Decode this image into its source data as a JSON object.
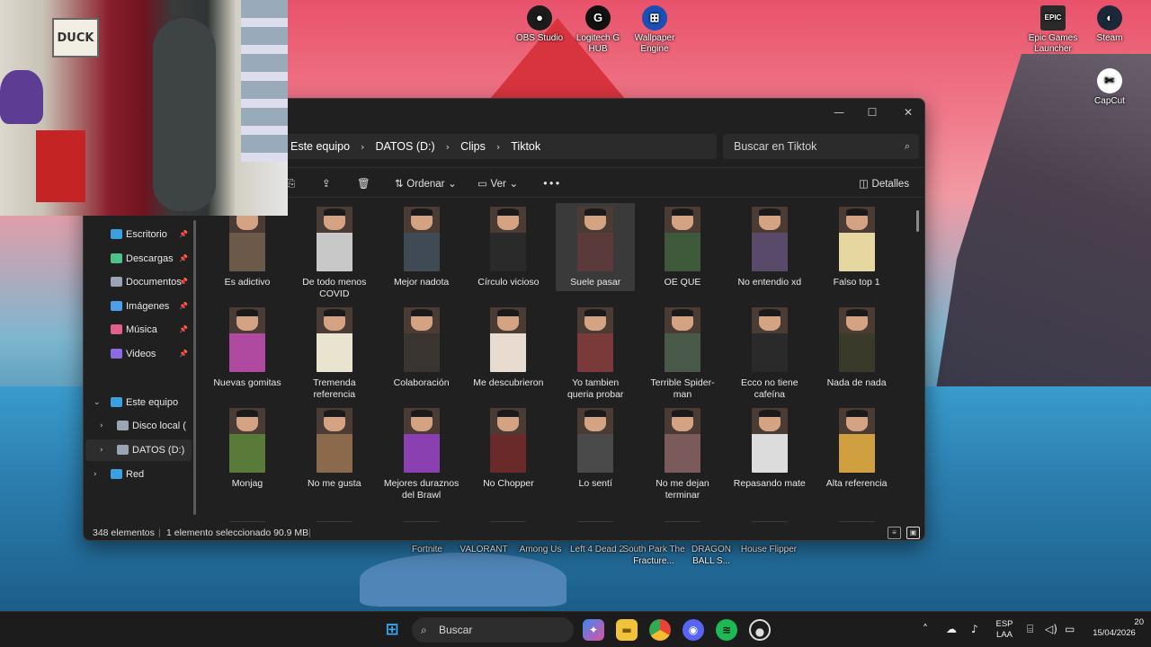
{
  "desktop": {
    "icons_top": [
      {
        "label": "OBS Studio",
        "icon": "obs-icon",
        "color": "#1b1b1b",
        "glyph": "●"
      },
      {
        "label": "Logitech G HUB",
        "icon": "logitech-icon",
        "color": "#111111",
        "glyph": "G"
      },
      {
        "label": "Wallpaper Engine",
        "icon": "wallpaper-engine-icon",
        "color": "#1a4fb5",
        "glyph": "⊞"
      },
      {
        "label": "Epic Games Launcher",
        "icon": "epic-games-icon",
        "color": "#2a2a2a",
        "glyph": "EPIC"
      },
      {
        "label": "Steam",
        "icon": "steam-icon",
        "color": "#1b2838",
        "glyph": "◐"
      },
      {
        "label": "CapCut",
        "icon": "capcut-icon",
        "color": "#ffffff",
        "glyph": "✂"
      }
    ],
    "icons_bottom": [
      "Fortnite",
      "VALORANT",
      "Among Us",
      "Left 4 Dead 2",
      "South Park The Fracture...",
      "DRAGON BALL S...",
      "House Flipper"
    ]
  },
  "webcam": {
    "sign_text": "DUCK"
  },
  "explorer": {
    "breadcrumb": [
      "Este equipo",
      "DATOS (D:)",
      "Clips",
      "Tiktok"
    ],
    "search_placeholder": "Buscar en Tiktok",
    "toolbar": {
      "sort_label": "Ordenar",
      "view_label": "Ver",
      "more_label": "•••",
      "details_label": "Detalles"
    },
    "nav": [
      {
        "label": "Escritorio",
        "icon": "desktop-icon",
        "color": "#3aa0e0",
        "pinned": true
      },
      {
        "label": "Descargas",
        "icon": "download-icon",
        "color": "#4cc28a",
        "pinned": true
      },
      {
        "label": "Documentos",
        "icon": "documents-icon",
        "color": "#9aa4b2",
        "pinned": true
      },
      {
        "label": "Imágenes",
        "icon": "images-icon",
        "color": "#4f9ee8",
        "pinned": true
      },
      {
        "label": "Música",
        "icon": "music-icon",
        "color": "#e0608a",
        "pinned": true
      },
      {
        "label": "Videos",
        "icon": "videos-icon",
        "color": "#8a6be0",
        "pinned": true
      },
      {
        "label": "Este equipo",
        "icon": "this-pc-icon",
        "color": "#3aa0e0",
        "pinned": false,
        "expanded": true
      },
      {
        "label": "Disco local (C:)",
        "icon": "drive-icon",
        "color": "#9aa4b2",
        "pinned": false,
        "expanded": false
      },
      {
        "label": "DATOS (D:)",
        "icon": "drive-icon",
        "color": "#9aa4b2",
        "pinned": false,
        "expanded": false,
        "selected": true
      },
      {
        "label": "Red",
        "icon": "network-icon",
        "color": "#3aa0e0",
        "pinned": false,
        "expanded": false
      }
    ],
    "files": [
      {
        "name": "Es adictivo",
        "bg": "#6b5a4a"
      },
      {
        "name": "De todo menos COVID",
        "bg": "#c8c8c8"
      },
      {
        "name": "Mejor nadota",
        "bg": "#3f4a55"
      },
      {
        "name": "Círculo vicioso",
        "bg": "#2a2a2a"
      },
      {
        "name": "Suele pasar",
        "bg": "#5a3a3a",
        "selected": true
      },
      {
        "name": "OE QUE",
        "bg": "#3e5a3a"
      },
      {
        "name": "No entendio xd",
        "bg": "#5a4a6a"
      },
      {
        "name": "Falso top 1",
        "bg": "#e6d6a0"
      },
      {
        "name": "Nuevas gomitas",
        "bg": "#b04aa0"
      },
      {
        "name": "Tremenda referencia",
        "bg": "#e8e4d0"
      },
      {
        "name": "Colaboración",
        "bg": "#3a3530"
      },
      {
        "name": "Me descubrieron",
        "bg": "#e8dcd0"
      },
      {
        "name": "Yo tambien queria probar",
        "bg": "#7a3a3a"
      },
      {
        "name": "Terrible Spider-man",
        "bg": "#4a5a4a"
      },
      {
        "name": "Ecco no tiene cafeína",
        "bg": "#2a2a2a"
      },
      {
        "name": "Nada de nada",
        "bg": "#3a3a2a"
      },
      {
        "name": "Monjag",
        "bg": "#5a7a3a"
      },
      {
        "name": "No me gusta",
        "bg": "#8a6a4a"
      },
      {
        "name": "Mejores duraznos del Brawl",
        "bg": "#8a40b0"
      },
      {
        "name": "No Chopper",
        "bg": "#6a2a2a"
      },
      {
        "name": "Lo sentí",
        "bg": "#4a4a4a"
      },
      {
        "name": "No me dejan terminar",
        "bg": "#7a5a5a"
      },
      {
        "name": "Repasando mate",
        "bg": "#dcdcdc"
      },
      {
        "name": "Alta referencia",
        "bg": "#d0a040"
      }
    ],
    "status": {
      "count": "348 elementos",
      "selected": "1 elemento seleccionado  90.9 MB"
    }
  },
  "taskbar": {
    "search_label": "Buscar",
    "lang_top": "ESP",
    "lang_bottom": "LAA",
    "time": "20",
    "date": "15/04/2026"
  }
}
